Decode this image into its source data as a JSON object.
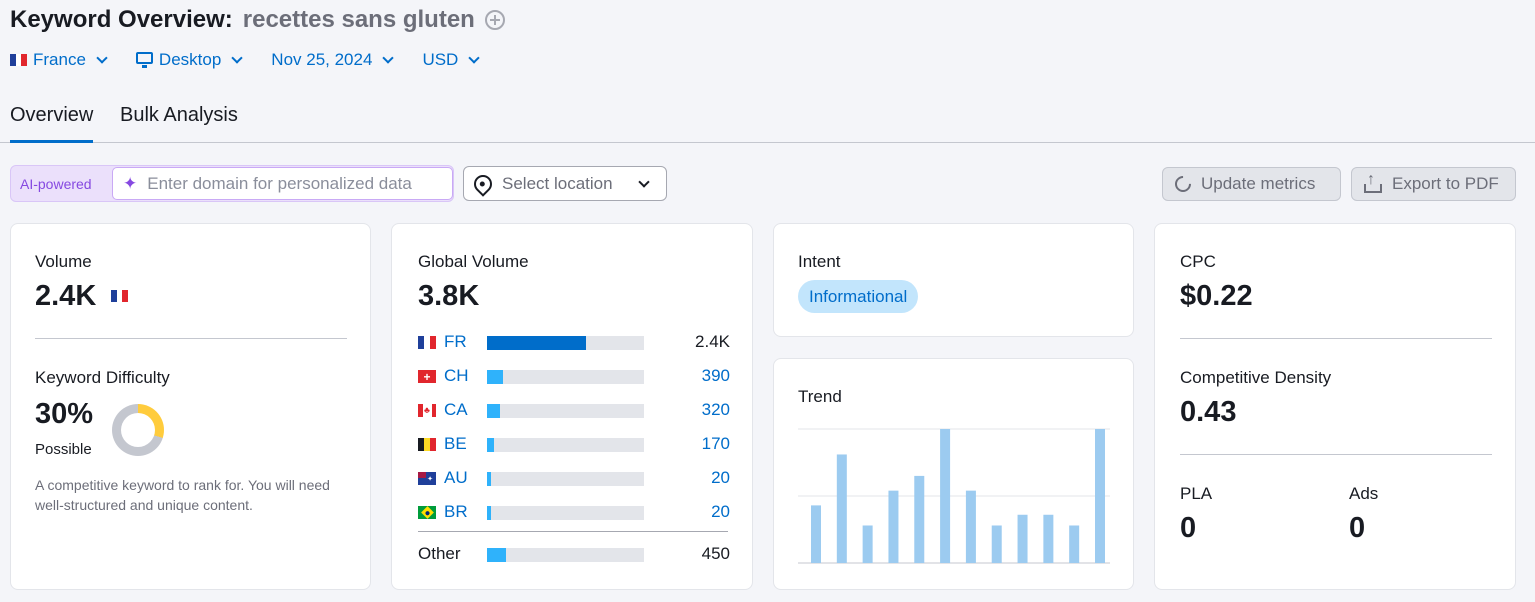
{
  "header": {
    "title": "Keyword Overview:",
    "keyword": "recettes sans gluten"
  },
  "filters": {
    "country": "France",
    "device": "Desktop",
    "date": "Nov 25, 2024",
    "currency": "USD"
  },
  "tabs": [
    "Overview",
    "Bulk Analysis"
  ],
  "toolbar": {
    "ai_label": "AI-powered",
    "domain_placeholder": "Enter domain for personalized data",
    "location_placeholder": "Select location",
    "update_label": "Update metrics",
    "export_label": "Export to PDF"
  },
  "colors": {
    "brand_blue": "#006dca",
    "bar_light_blue": "#2fb2fb",
    "trend_bar": "#9ccbf0",
    "difficulty_yellow": "#ffcc3d",
    "ai_purple": "#8649e1"
  },
  "volume_card": {
    "volume_label": "Volume",
    "volume_value": "2.4K",
    "kd_label": "Keyword Difficulty",
    "kd_value": "30%",
    "kd_text": "Possible",
    "kd_percent": 30,
    "kd_description": "A competitive keyword to rank for. You will need well-structured and unique content."
  },
  "global_card": {
    "label": "Global Volume",
    "value": "3.8K",
    "countries": [
      {
        "code": "FR",
        "value": "2.4K",
        "share": 0.63,
        "flag": "flag-france-icon"
      },
      {
        "code": "CH",
        "value": "390",
        "share": 0.1,
        "flag": "flag-switzerland-icon"
      },
      {
        "code": "CA",
        "value": "320",
        "share": 0.08,
        "flag": "flag-canada-icon"
      },
      {
        "code": "BE",
        "value": "170",
        "share": 0.045,
        "flag": "flag-belgium-icon"
      },
      {
        "code": "AU",
        "value": "20",
        "share": 0.02,
        "flag": "flag-australia-icon"
      },
      {
        "code": "BR",
        "value": "20",
        "share": 0.02,
        "flag": "flag-brazil-icon"
      }
    ],
    "other_label": "Other",
    "other_value": "450",
    "other_share": 0.12
  },
  "intent_card": {
    "label": "Intent",
    "badge": "Informational"
  },
  "trend_card": {
    "label": "Trend"
  },
  "cpc_card": {
    "cpc_label": "CPC",
    "cpc_value": "$0.22",
    "density_label": "Competitive Density",
    "density_value": "0.43",
    "pla_label": "PLA",
    "pla_value": "0",
    "ads_label": "Ads",
    "ads_value": "0"
  },
  "chart_data": {
    "type": "bar",
    "title": "Trend",
    "values": [
      0.43,
      0.81,
      0.28,
      0.54,
      0.65,
      1.0,
      0.54,
      0.28,
      0.36,
      0.36,
      0.28,
      1.0
    ],
    "ylim": [
      0,
      1
    ],
    "grid": true
  }
}
